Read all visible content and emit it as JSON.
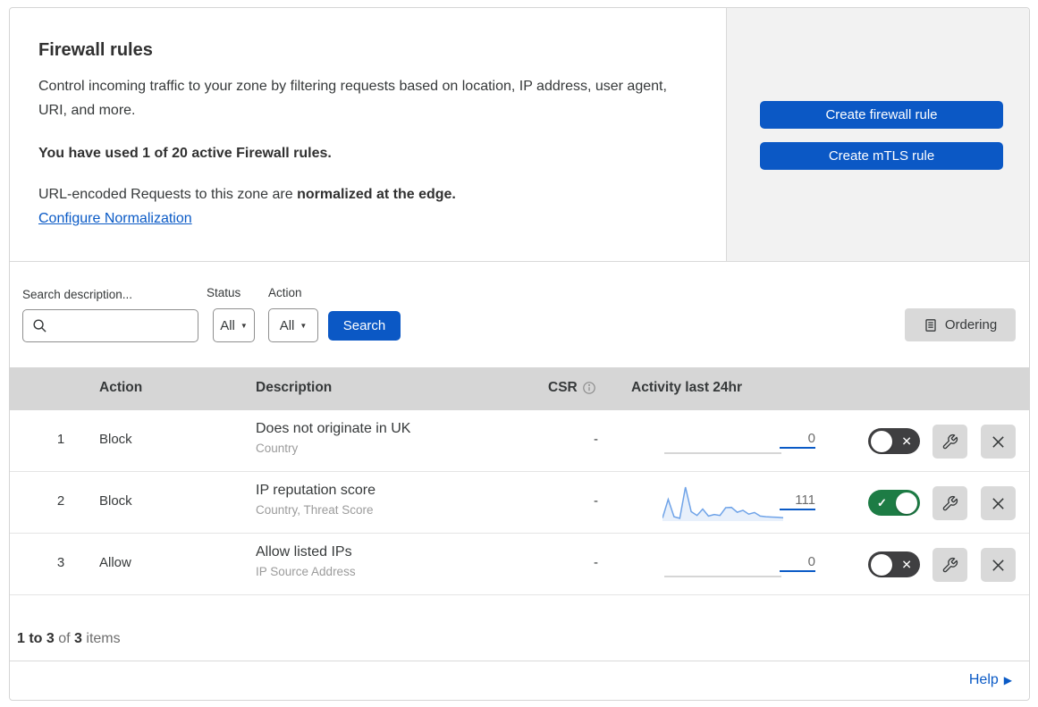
{
  "header": {
    "title": "Firewall rules",
    "description": "Control incoming traffic to your zone by filtering requests based on location, IP address, user agent, URI, and more.",
    "usage": "You have used 1 of 20 active Firewall rules.",
    "norm_prefix": "URL-encoded Requests to this zone are ",
    "norm_bold": "normalized at the edge.",
    "link_label": "Configure Normalization",
    "create_firewall_button": "Create firewall rule",
    "create_mtls_button": "Create mTLS rule"
  },
  "filters": {
    "search_label": "Search description...",
    "search_value": "",
    "status_label": "Status",
    "status_value": "All",
    "action_label": "Action",
    "action_value": "All",
    "search_button": "Search",
    "ordering_button": "Ordering"
  },
  "table": {
    "columns": {
      "action": "Action",
      "description": "Description",
      "csr": "CSR",
      "activity": "Activity last 24hr"
    },
    "rows": [
      {
        "priority": "1",
        "action": "Block",
        "description": "Does not originate in UK",
        "criteria": "Country",
        "csr": "-",
        "activity_count": "0",
        "enabled": false,
        "sparkline_values": null
      },
      {
        "priority": "2",
        "action": "Block",
        "description": "IP reputation score",
        "criteria": "Country, Threat Score",
        "csr": "-",
        "activity_count": "111",
        "enabled": true,
        "sparkline_values": [
          4,
          62,
          8,
          3,
          100,
          24,
          12,
          32,
          10,
          15,
          12,
          36,
          37,
          22,
          28,
          16,
          21,
          10,
          8,
          7,
          6,
          5
        ]
      },
      {
        "priority": "3",
        "action": "Allow",
        "description": "Allow listed IPs",
        "criteria": "IP Source Address",
        "csr": "-",
        "activity_count": "0",
        "enabled": false,
        "sparkline_values": null
      }
    ]
  },
  "footer": {
    "range": "1 to 3",
    "of_word": "of",
    "total": "3",
    "items_word": "items",
    "help_label": "Help"
  },
  "icons": {
    "check": "✓",
    "cross": "✕",
    "caret": "▼",
    "help_arrow": "▶"
  },
  "colors": {
    "accent_blue": "#0b58c5",
    "link_blue": "#0a5ac6",
    "toggle_on_green": "#1d7c45",
    "toggle_off_gray": "#3f3f41",
    "sparkline_blue": "#6fa3e8",
    "sparkline_fill": "rgba(111,163,232,0.16)",
    "empty_line_gray": "#c9c9c9",
    "table_header_bg": "#d6d6d6"
  }
}
